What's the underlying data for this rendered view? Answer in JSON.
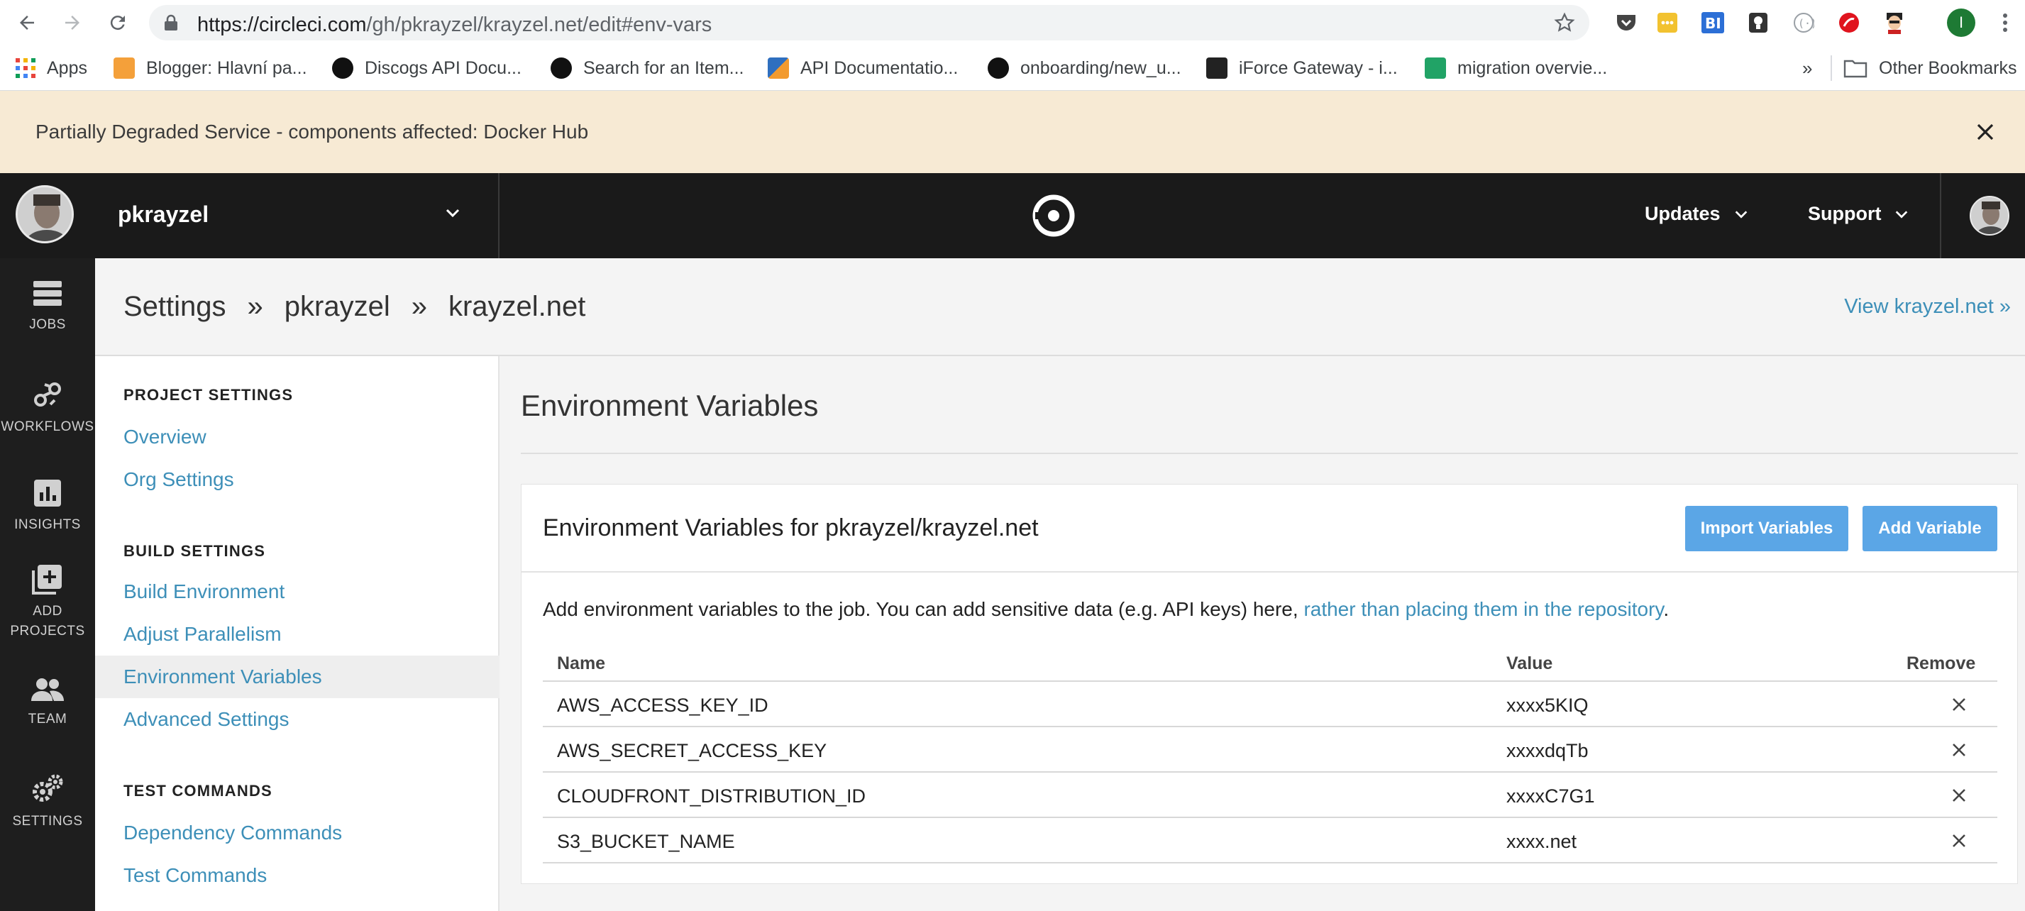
{
  "browser": {
    "url_host": "https://circleci.com",
    "url_path": "/gh/pkrayzel/krayzel.net/edit#env-vars",
    "bookmarks": [
      {
        "label": "Apps",
        "color": "#e8453c"
      },
      {
        "label": "Blogger: Hlavní pa...",
        "color": "#f4a03a"
      },
      {
        "label": "Discogs API Docu...",
        "color": "#111111"
      },
      {
        "label": "Search for an Item...",
        "color": "#111111"
      },
      {
        "label": "API Documentatio...",
        "color": "#2f6fbf"
      },
      {
        "label": "onboarding/new_u...",
        "color": "#111111"
      },
      {
        "label": "iForce Gateway - i...",
        "color": "#222222"
      },
      {
        "label": "migration overvie...",
        "color": "#21a366"
      }
    ],
    "bookmarks_more": "»",
    "other_bookmarks": "Other Bookmarks",
    "profile_initial": "I"
  },
  "banner": {
    "message": "Partially Degraded Service - components affected: Docker Hub"
  },
  "header": {
    "org_name": "pkrayzel",
    "menu": [
      {
        "label": "Updates"
      },
      {
        "label": "Support"
      }
    ]
  },
  "leftnav": {
    "items": [
      {
        "label": "JOBS",
        "icon": "jobs-icon"
      },
      {
        "label": "WORKFLOWS",
        "icon": "workflows-icon"
      },
      {
        "label": "INSIGHTS",
        "icon": "insights-icon"
      },
      {
        "label": "ADD PROJECTS",
        "icon": "add-projects-icon"
      },
      {
        "label": "TEAM",
        "icon": "team-icon"
      },
      {
        "label": "SETTINGS",
        "icon": "settings-icon"
      }
    ]
  },
  "page": {
    "crumbs": [
      "Settings",
      "pkrayzel",
      "krayzel.net"
    ],
    "crumb_sep": "»",
    "view_link": "View krayzel.net »"
  },
  "sidebar": {
    "sections": [
      {
        "heading": "PROJECT SETTINGS",
        "links": [
          "Overview",
          "Org Settings"
        ]
      },
      {
        "heading": "BUILD SETTINGS",
        "links": [
          "Build Environment",
          "Adjust Parallelism",
          "Environment Variables",
          "Advanced Settings"
        ]
      },
      {
        "heading": "TEST COMMANDS",
        "links": [
          "Dependency Commands",
          "Test Commands"
        ]
      }
    ],
    "active": "Environment Variables"
  },
  "main": {
    "title": "Environment Variables",
    "card_title": "Environment Variables for pkrayzel/krayzel.net",
    "import_button": "Import Variables",
    "add_button": "Add Variable",
    "desc_text": "Add environment variables to the job. You can add sensitive data (e.g. API keys) here, ",
    "desc_link": "rather than placing them in the repository",
    "desc_end": ".",
    "table": {
      "headers": {
        "name": "Name",
        "value": "Value",
        "remove": "Remove"
      },
      "rows": [
        {
          "name": "AWS_ACCESS_KEY_ID",
          "value": "xxxx5KIQ"
        },
        {
          "name": "AWS_SECRET_ACCESS_KEY",
          "value": "xxxxdqTb"
        },
        {
          "name": "CLOUDFRONT_DISTRIBUTION_ID",
          "value": "xxxxC7G1"
        },
        {
          "name": "S3_BUCKET_NAME",
          "value": "xxxx.net"
        }
      ]
    }
  },
  "colors": {
    "accent_link": "#3d8fb8",
    "button": "#5ba6e6",
    "banner": "#f7ead4",
    "header": "#1a1a1a"
  }
}
